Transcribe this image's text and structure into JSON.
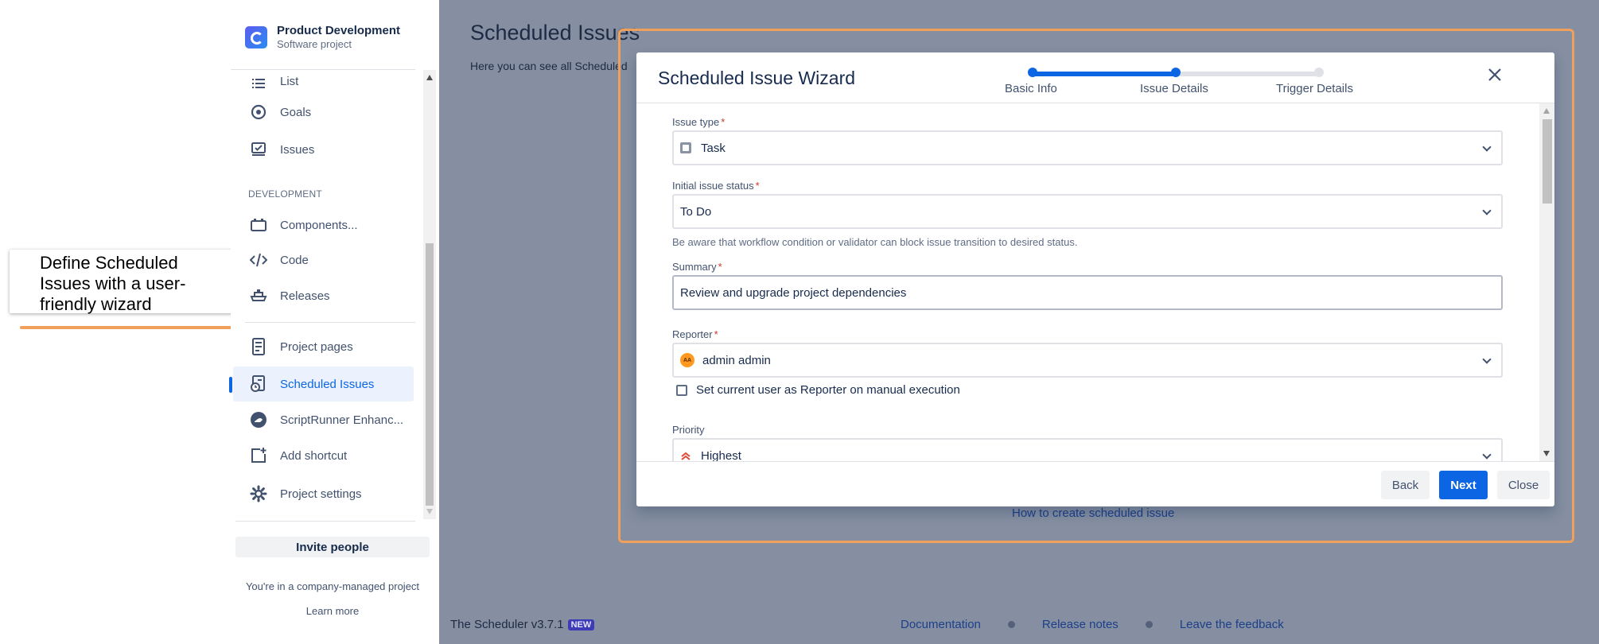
{
  "callout": {
    "text": "Define Scheduled Issues with a user-friendly wizard"
  },
  "sidebar": {
    "project_name": "Product Development",
    "project_type": "Software project",
    "items_top": [
      {
        "label": "List",
        "icon": "list-icon"
      },
      {
        "label": "Goals",
        "icon": "goals-icon"
      },
      {
        "label": "Issues",
        "icon": "issues-icon"
      }
    ],
    "section_development": "DEVELOPMENT",
    "items_dev": [
      {
        "label": "Components...",
        "icon": "components-icon"
      },
      {
        "label": "Code",
        "icon": "code-icon"
      },
      {
        "label": "Releases",
        "icon": "ship-icon"
      }
    ],
    "items_bottom": [
      {
        "label": "Project pages",
        "icon": "page-icon"
      },
      {
        "label": "Scheduled Issues",
        "icon": "scheduled-issues-icon",
        "active": true
      },
      {
        "label": "ScriptRunner Enhanc...",
        "icon": "scriptrunner-icon"
      },
      {
        "label": "Add shortcut",
        "icon": "add-shortcut-icon"
      },
      {
        "label": "Project settings",
        "icon": "gear-icon"
      }
    ],
    "invite_label": "Invite people",
    "managed_text": "You're in a company-managed project",
    "learn_more": "Learn more"
  },
  "main": {
    "title": "Scheduled Issues",
    "subtitle": "Here you can see all Scheduled",
    "help_link": "How to create scheduled issue",
    "version": "The Scheduler v3.7.1",
    "badge_new": "NEW",
    "footer_links": [
      "Documentation",
      "Release notes",
      "Leave the feedback"
    ]
  },
  "modal": {
    "title": "Scheduled Issue Wizard",
    "steps": [
      {
        "label": "Basic Info",
        "state": "done"
      },
      {
        "label": "Issue Details",
        "state": "current"
      },
      {
        "label": "Trigger Details",
        "state": "pending"
      }
    ],
    "fields": {
      "issue_type": {
        "label": "Issue type",
        "value": "Task"
      },
      "initial_status": {
        "label": "Initial issue status",
        "value": "To Do",
        "help": "Be aware that workflow condition or validator can block issue transition to desired status."
      },
      "summary": {
        "label": "Summary",
        "value": "Review and upgrade project dependencies"
      },
      "reporter": {
        "label": "Reporter",
        "value": "admin admin",
        "avatar": "AA",
        "checkbox_label": "Set current user as Reporter on manual execution",
        "checkbox_checked": false
      },
      "priority": {
        "label": "Priority",
        "value": "Highest"
      }
    },
    "required_mark": "*",
    "buttons": {
      "back": "Back",
      "next": "Next",
      "close": "Close"
    }
  },
  "colors": {
    "accent": "#0c66e4",
    "highlight": "#f0a05a",
    "overlay": "#858fa1",
    "required": "#c9372c"
  }
}
